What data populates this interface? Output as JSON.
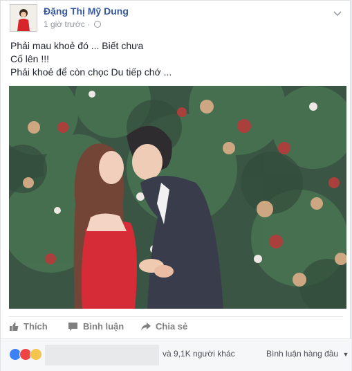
{
  "post": {
    "author": "Đặng Thị Mỹ Dung",
    "time": "1 giờ trước",
    "text_lines": [
      "Phải mau khoẻ đó ... Biết chưa",
      "Cố lên !!!",
      "Phải khoẻ để còn chọc Du tiếp chớ ..."
    ]
  },
  "actions": {
    "like_label": "Thích",
    "comment_label": "Bình luận",
    "share_label": "Chia sẻ"
  },
  "footer": {
    "reaction_icons": [
      "like-icon",
      "love-icon",
      "sad-icon"
    ],
    "others_text": "và 9,1K người khác",
    "sort_label": "Bình luận hàng đầu"
  },
  "colors": {
    "link": "#365899",
    "meta": "#90949c",
    "like": "#3b82f6",
    "love": "#ef4444",
    "sad": "#f5c451"
  }
}
